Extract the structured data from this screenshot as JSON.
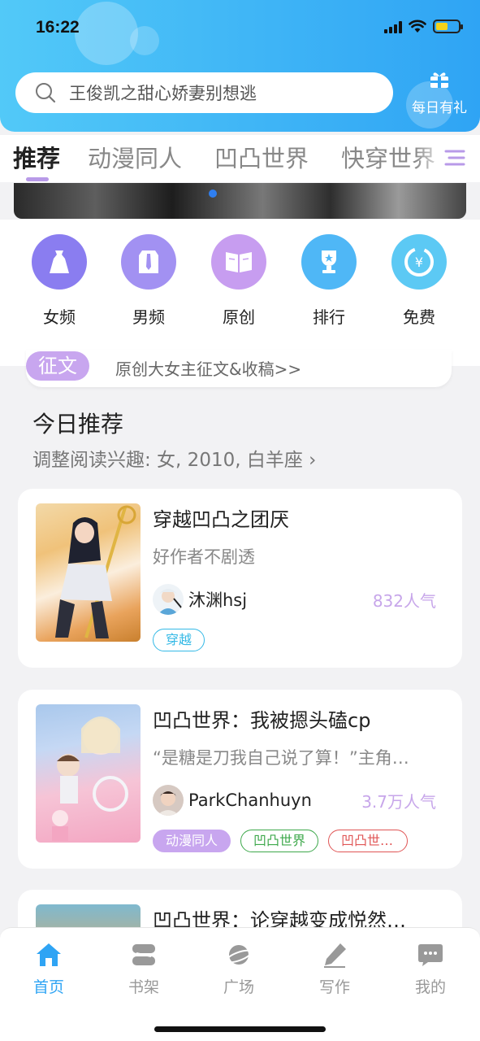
{
  "status": {
    "time": "16:22"
  },
  "search": {
    "placeholder": "王俊凯之甜心娇妻别想逃"
  },
  "gift": {
    "label": "每日有礼"
  },
  "tabs": [
    {
      "label": "推荐",
      "active": true
    },
    {
      "label": "动漫同人"
    },
    {
      "label": "凹凸世界"
    },
    {
      "label": "快穿世界"
    }
  ],
  "categories": [
    {
      "label": "女频",
      "icon": "dress-icon",
      "color": "#8a7df0"
    },
    {
      "label": "男频",
      "icon": "suit-icon",
      "color": "#a291f2"
    },
    {
      "label": "原创",
      "icon": "book-icon",
      "color": "#c79df0"
    },
    {
      "label": "排行",
      "icon": "trophy-icon",
      "color": "#4fb7f6"
    },
    {
      "label": "免费",
      "icon": "yuan-icon",
      "color": "#5cc9f4"
    }
  ],
  "notice": {
    "tag": "征文",
    "text": "原创大女主征文&收稿>>"
  },
  "section": {
    "title": "今日推荐",
    "subtitle": "调整阅读兴趣: 女, 2010, 白羊座 ›"
  },
  "books": [
    {
      "title": "穿越凹凸之团厌",
      "desc": "好作者不剧透",
      "author": "沐渊hsj",
      "popularity": "832人气",
      "tags": [
        {
          "label": "穿越",
          "style": "cyan"
        }
      ]
    },
    {
      "title": "凹凸世界：我被摁头磕cp",
      "desc": "“是糖是刀我自己说了算！”主角…",
      "author": "ParkChanhuyn",
      "popularity": "3.7万人气",
      "tags": [
        {
          "label": "动漫同人",
          "style": "purple"
        },
        {
          "label": "凹凸世界",
          "style": "green"
        },
        {
          "label": "凹凸世…",
          "style": "red"
        }
      ]
    },
    {
      "title": "凹凸世界：论穿越变成悦然…"
    }
  ],
  "nav": [
    {
      "label": "首页",
      "icon": "home-icon",
      "active": true
    },
    {
      "label": "书架",
      "icon": "bookshelf-icon"
    },
    {
      "label": "广场",
      "icon": "planet-icon"
    },
    {
      "label": "写作",
      "icon": "pencil-icon"
    },
    {
      "label": "我的",
      "icon": "chat-bubble-icon"
    }
  ],
  "colors": {
    "accent": "#2fa4f4",
    "purple": "#c8a6ef"
  }
}
